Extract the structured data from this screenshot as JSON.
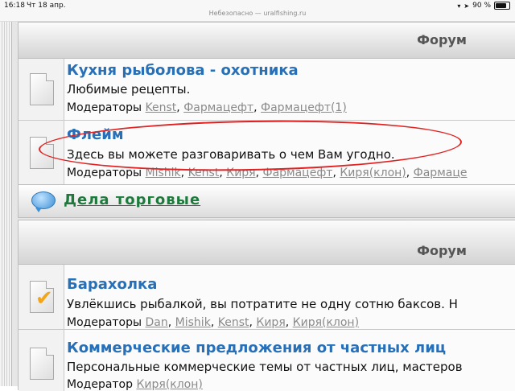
{
  "status_bar": {
    "time": "16:18",
    "date": "Чт 18 апр.",
    "url_text": "Небезопасно — uralfishing.ru",
    "battery_text": "90 %",
    "battery_fraction": 0.9,
    "wifi_icon": "wifi-icon",
    "location_icon": "location-icon"
  },
  "sections": [
    {
      "column_title": "Форум",
      "forums": [
        {
          "title": "Кухня рыболова - охотника",
          "description": "Любимые рецепты.",
          "moderators_label": "Модераторы",
          "moderators": [
            "Kenst",
            "Фармацефт",
            "Фармацефт(1)"
          ],
          "icon": "document-icon"
        },
        {
          "title": "Флейм",
          "description": "Здесь вы можете разговаривать о чем Вам угодно.",
          "moderators_label": "Модераторы",
          "moderators": [
            "Mishik",
            "Kenst",
            "Киря",
            "Фармацефт",
            "Киря(клон)",
            "Фармаце"
          ],
          "icon": "document-icon"
        }
      ]
    },
    {
      "category_title": "Дела торговые",
      "column_title": "Форум",
      "forums": [
        {
          "title": "Барахолка",
          "description": "Увлёкшись рыбалкой, вы потратите не одну сотню баксов. Н",
          "moderators_label": "Модераторы",
          "moderators": [
            "Dan",
            "Mishik",
            "Kenst",
            "Киря",
            "Киря(клон)"
          ],
          "icon": "checked-document-icon"
        },
        {
          "title": "Коммерческие предложения от частных лиц",
          "description": "Персональные коммерческие темы от частных лиц, мастеров",
          "moderators_label": "Модератор",
          "moderators": [
            "Киря(клон)"
          ],
          "icon": "document-icon"
        }
      ]
    }
  ],
  "colors": {
    "forum_title": "#2770b8",
    "category_title": "#1e7a3c",
    "moderator_link": "#8a8a8a",
    "annotation": "#e02222"
  }
}
